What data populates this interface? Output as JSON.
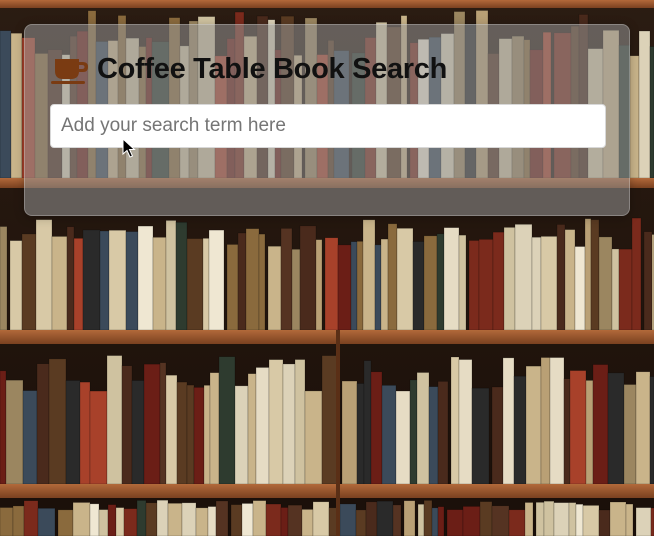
{
  "app": {
    "title": "Coffee Table Book Search"
  },
  "header": {
    "icon": "coffee-cup-icon",
    "icon_color": "#7a3b12"
  },
  "search": {
    "value": "",
    "placeholder": "Add your search term here"
  },
  "background": {
    "image": "bookshelf-photo",
    "shelf_color": "#9c5a2e"
  }
}
